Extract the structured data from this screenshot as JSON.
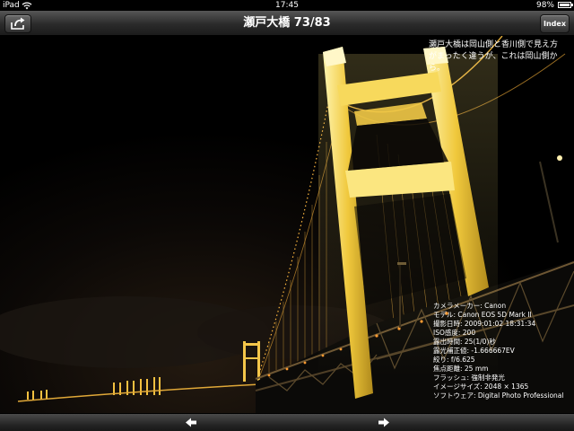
{
  "status_bar": {
    "carrier": "iPad",
    "time": "17:45",
    "battery": "98%",
    "battery_level": 0.98,
    "icons": [
      "wifi-icon",
      "battery-icon"
    ]
  },
  "nav_bar": {
    "title": "瀬戸大橋 73/83",
    "share_icon": "share-icon",
    "index_label": "Index"
  },
  "photo": {
    "subject": "bridge-photo",
    "caption": "瀬戸大橋は岡山側と香川側で見え方がまったく違うが、これは岡山側から。",
    "exif": [
      "カメラメーカー: Canon",
      "モデル: Canon EOS 5D Mark II",
      "撮影日時: 2009:01:02 18:31:34",
      "ISO感度: 200",
      "露出時間: 25(1/0)秒",
      "露光補正値: -1.666667EV",
      "絞り: f/6.625",
      "焦点距離: 25 mm",
      "フラッシュ: 強制非発光",
      "イメージサイズ: 2048 × 1365",
      "ソフトウェア: Digital Photo Professional"
    ]
  },
  "toolbar": {
    "prev_icon": "left-arrow-icon",
    "next_icon": "right-arrow-icon"
  },
  "colors": {
    "tower": "#e8c23a",
    "tower_highlight": "#fff3a0",
    "lights": "#ffbf40",
    "sky": "#000000"
  }
}
